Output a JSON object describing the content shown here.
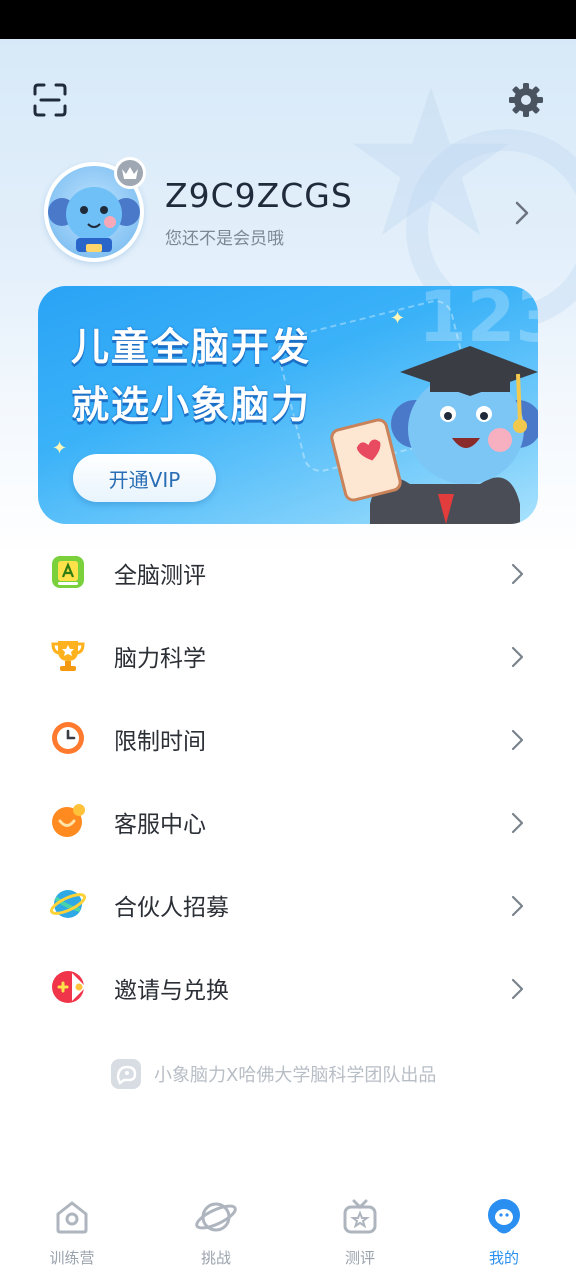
{
  "profile": {
    "username": "Z9C9ZCGS",
    "member_status": "您还不是会员哦"
  },
  "banner": {
    "title_line1": "儿童全脑开发",
    "title_line2": "就选小象脑力",
    "vip_button": "开通VIP",
    "deco_numbers": "123"
  },
  "menu": {
    "items": [
      {
        "label": "全脑测评",
        "icon": "assessment-icon"
      },
      {
        "label": "脑力科学",
        "icon": "trophy-icon"
      },
      {
        "label": "限制时间",
        "icon": "clock-icon"
      },
      {
        "label": "客服中心",
        "icon": "chat-icon"
      },
      {
        "label": "合伙人招募",
        "icon": "planet-icon"
      },
      {
        "label": "邀请与兑换",
        "icon": "gamepad-icon"
      }
    ]
  },
  "footer": {
    "credit": "小象脑力X哈佛大学脑科学团队出品"
  },
  "bottom_nav": {
    "tabs": [
      {
        "label": "训练营",
        "active": false
      },
      {
        "label": "挑战",
        "active": false
      },
      {
        "label": "测评",
        "active": false
      },
      {
        "label": "我的",
        "active": true
      }
    ]
  },
  "colors": {
    "accent": "#2a8ff0",
    "banner": "#2aa3f5",
    "text_primary": "#2b2f36",
    "text_muted": "#9aa2ac"
  }
}
